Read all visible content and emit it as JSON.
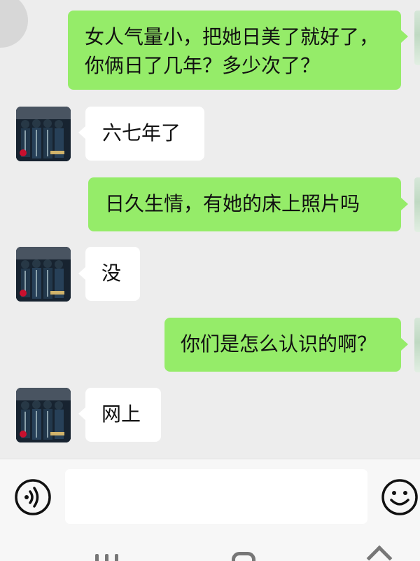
{
  "messages": [
    {
      "side": "me",
      "lines": [
        "女人气量小，把她日美了就好了，",
        "你俩日了几年？多少次了？"
      ]
    },
    {
      "side": "them",
      "lines": [
        "六七年了"
      ]
    },
    {
      "side": "me",
      "lines": [
        "日久生情，有她的床上照片吗"
      ]
    },
    {
      "side": "them",
      "lines": [
        "没"
      ]
    },
    {
      "side": "me",
      "lines": [
        "你们是怎么认识的啊？"
      ]
    },
    {
      "side": "them",
      "lines": [
        "网上"
      ]
    }
  ],
  "input_bar": {
    "message_value": "",
    "voice_icon": "voice-icon",
    "emoji_icon": "emoji-icon"
  },
  "nav": {
    "recents_icon": "recents-icon",
    "home_icon": "home-icon",
    "back_icon": "back-icon"
  },
  "colors": {
    "background": "#ededed",
    "outgoing_bubble": "#95ec69",
    "incoming_bubble": "#ffffff",
    "input_bar": "#f7f7f7"
  }
}
